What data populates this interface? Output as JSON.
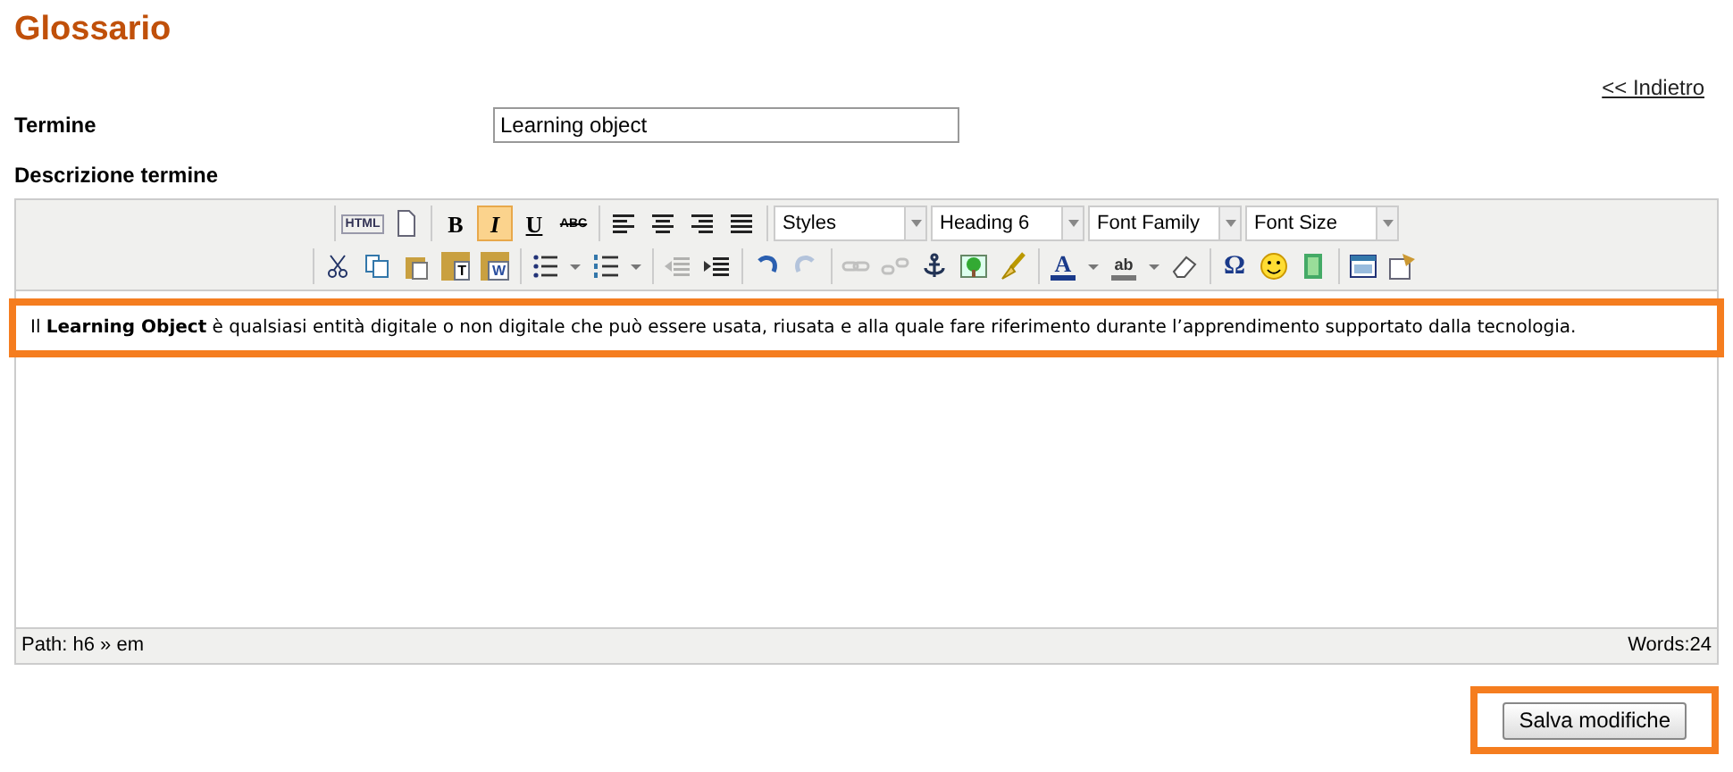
{
  "title": "Glossario",
  "back_link": "<< Indietro",
  "term": {
    "label": "Termine",
    "value": "Learning object"
  },
  "description": {
    "label": "Descrizione termine"
  },
  "toolbar": [
    {
      "groups": [
        {
          "items": [
            {
              "kind": "html",
              "label": "HTML",
              "active": false,
              "disabled": false
            },
            {
              "kind": "newdoc",
              "active": false,
              "disabled": false
            }
          ]
        },
        {
          "items": [
            {
              "kind": "bold",
              "label": "B",
              "active": false,
              "disabled": false
            },
            {
              "kind": "italic",
              "label": "I",
              "active": true,
              "disabled": false
            },
            {
              "kind": "underline",
              "label": "U",
              "active": false,
              "disabled": false
            },
            {
              "kind": "strike",
              "label": "ABC",
              "active": false,
              "disabled": false
            }
          ]
        },
        {
          "items": [
            {
              "kind": "align-left",
              "active": false,
              "disabled": false
            },
            {
              "kind": "align-center",
              "active": false,
              "disabled": false
            },
            {
              "kind": "align-right",
              "active": false,
              "disabled": false
            },
            {
              "kind": "align-justify",
              "active": false,
              "disabled": false
            }
          ]
        },
        {
          "items": [
            {
              "kind": "select",
              "value": "Styles"
            },
            {
              "kind": "select",
              "value": "Heading 6"
            },
            {
              "kind": "select",
              "value": "Font Family"
            },
            {
              "kind": "select",
              "value": "Font Size"
            }
          ]
        }
      ]
    },
    {
      "groups": [
        {
          "items": [
            {
              "kind": "cut",
              "active": false,
              "disabled": false
            },
            {
              "kind": "copy",
              "active": false,
              "disabled": false
            },
            {
              "kind": "paste",
              "active": false,
              "disabled": false
            },
            {
              "kind": "paste-text",
              "label": "T",
              "active": false,
              "disabled": false
            },
            {
              "kind": "paste-word",
              "label": "W",
              "active": false,
              "disabled": false
            }
          ]
        },
        {
          "items": [
            {
              "kind": "bullist",
              "active": false,
              "disabled": false
            },
            {
              "kind": "dropdown",
              "active": false,
              "disabled": false
            },
            {
              "kind": "numlist",
              "active": false,
              "disabled": false
            },
            {
              "kind": "dropdown",
              "active": false,
              "disabled": false
            }
          ]
        },
        {
          "items": [
            {
              "kind": "outdent",
              "active": false,
              "disabled": true
            },
            {
              "kind": "indent",
              "active": false,
              "disabled": false
            }
          ]
        },
        {
          "items": [
            {
              "kind": "undo",
              "active": false,
              "disabled": false
            },
            {
              "kind": "redo",
              "active": false,
              "disabled": true
            }
          ]
        },
        {
          "items": [
            {
              "kind": "link",
              "active": false,
              "disabled": true
            },
            {
              "kind": "unlink",
              "active": false,
              "disabled": true
            },
            {
              "kind": "anchor",
              "active": false,
              "disabled": false
            },
            {
              "kind": "image",
              "active": false,
              "disabled": false
            },
            {
              "kind": "cleanup",
              "active": false,
              "disabled": false
            }
          ]
        },
        {
          "items": [
            {
              "kind": "forecolor",
              "label": "A",
              "active": false,
              "disabled": false
            },
            {
              "kind": "dropdown",
              "active": false,
              "disabled": false
            },
            {
              "kind": "backcolor",
              "label": "ab",
              "active": false,
              "disabled": false
            },
            {
              "kind": "dropdown",
              "active": false,
              "disabled": false
            },
            {
              "kind": "eraser",
              "active": false,
              "disabled": false
            }
          ]
        },
        {
          "items": [
            {
              "kind": "charmap",
              "label": "Ω",
              "active": false,
              "disabled": false
            },
            {
              "kind": "emoticon",
              "active": false,
              "disabled": false
            },
            {
              "kind": "media",
              "active": false,
              "disabled": false
            }
          ]
        },
        {
          "items": [
            {
              "kind": "preview",
              "active": false,
              "disabled": false
            },
            {
              "kind": "template",
              "active": false,
              "disabled": false
            }
          ]
        }
      ]
    }
  ],
  "content": "Il **Learning Object** è qualsiasi entità digitale o non digitale che può essere usata, riusata e alla quale fare riferimento durante l’apprendimento supportato dalla tecnologia.",
  "status_path": "Path: h6 » em",
  "word_count": "Words:24",
  "save_button": "Salva modifiche"
}
